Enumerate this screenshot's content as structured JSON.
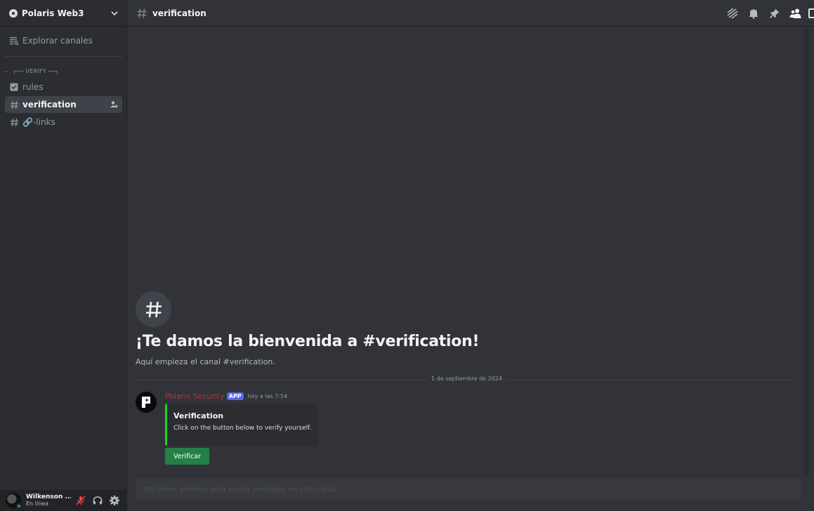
{
  "server": {
    "name": "Polaris Web3"
  },
  "sidebar": {
    "explore_label": "Explorar canales",
    "category": "╭── VERIFY ──╮",
    "channels": [
      {
        "label": "rules",
        "icon": "rules-icon"
      },
      {
        "label": "verification",
        "icon": "hash-icon",
        "active": true
      },
      {
        "label": "🔗-links",
        "icon": "hash-icon"
      }
    ]
  },
  "user": {
    "name": "Wilkenson ...",
    "status": "En línea",
    "status_color": "#23a55a"
  },
  "topbar": {
    "channel": "verification"
  },
  "welcome": {
    "title": "¡Te damos la bienvenida a #verification!",
    "subtitle": "Aquí empieza el canal #verification."
  },
  "date_divider": "1 de septiembre de 2024",
  "message": {
    "author": "Polaris Security",
    "author_color": "#a8383d",
    "badge": "APP",
    "timestamp": "hoy a las 7:54",
    "embed": {
      "title": "Verification",
      "description": "Click on the button below to verify yourself.",
      "accent_color": "#1dd51b"
    },
    "button_label": "Verificar",
    "button_color": "#248046"
  },
  "input": {
    "placeholder": "No tienes permiso para enviar mensajes en este canal."
  }
}
